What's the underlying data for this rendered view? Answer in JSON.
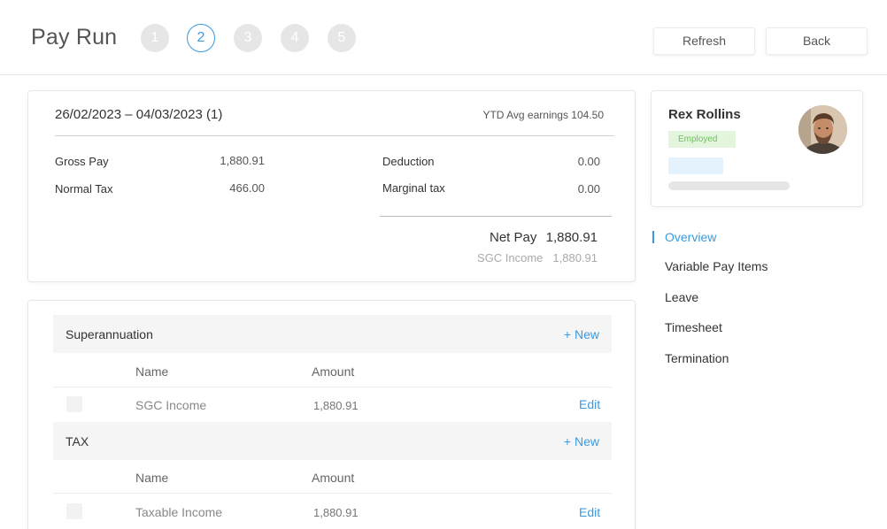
{
  "header": {
    "title": "Pay Run",
    "steps": [
      "1",
      "2",
      "3",
      "4",
      "5"
    ],
    "active_step": 2,
    "refresh_label": "Refresh",
    "back_label": "Back"
  },
  "summary": {
    "period": "26/02/2023 – 04/03/2023 (1)",
    "ytd": "YTD Avg earnings 104.50",
    "gross_pay_label": "Gross Pay",
    "gross_pay_value": "1,880.91",
    "normal_tax_label": "Normal Tax",
    "normal_tax_value": "466.00",
    "deduction_label": "Deduction",
    "deduction_value": "0.00",
    "marginal_tax_label": "Marginal tax",
    "marginal_tax_value": "0.00",
    "net_pay_label": "Net Pay",
    "net_pay_value": "1,880.91",
    "sgc_label": "SGC Income",
    "sgc_value": "1,880.91"
  },
  "sections": [
    {
      "title": "Superannuation",
      "new_label": "+ New",
      "col_name": "Name",
      "col_amount": "Amount",
      "row_name": "SGC Income",
      "row_amount": "1,880.91",
      "edit_label": "Edit"
    },
    {
      "title": "TAX",
      "new_label": "+ New",
      "col_name": "Name",
      "col_amount": "Amount",
      "row_name": "Taxable Income",
      "row_amount": "1,880.91",
      "edit_label": "Edit"
    }
  ],
  "employee": {
    "name": "Rex Rollins",
    "status": "Employed"
  },
  "nav": [
    "Overview",
    "Variable Pay Items",
    "Leave",
    "Timesheet",
    "Termination"
  ],
  "colors": {
    "accent": "#3a9ae0",
    "status_bg": "#e3f6dd",
    "status_text": "#6cbf58"
  }
}
